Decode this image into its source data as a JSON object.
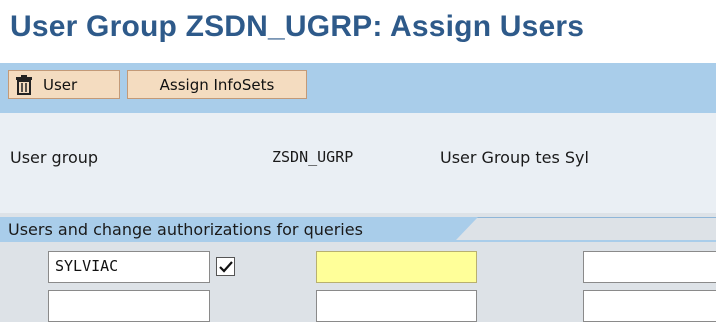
{
  "page": {
    "title": "User Group ZSDN_UGRP: Assign Users"
  },
  "toolbar": {
    "user_button_label": "User",
    "user_button_icon": "trash-icon",
    "assign_infosets_label": "Assign InfoSets"
  },
  "header": {
    "user_group_label": "User group",
    "user_group_value": "ZSDN_UGRP",
    "user_group_description": "User Group tes Syl"
  },
  "section": {
    "tab_title": "Users and change authorizations for queries"
  },
  "rows": [
    {
      "user": "SYLVIAC",
      "change_auth_checked": true,
      "field2": "",
      "field3": ""
    },
    {
      "user": "",
      "change_auth_checked": false,
      "field2": "",
      "field3": ""
    }
  ],
  "colors": {
    "title": "#2e5a8a",
    "toolbar_bg": "#a9cdea",
    "button_bg": "#f4dcc0",
    "active_field": "#ffff99"
  }
}
